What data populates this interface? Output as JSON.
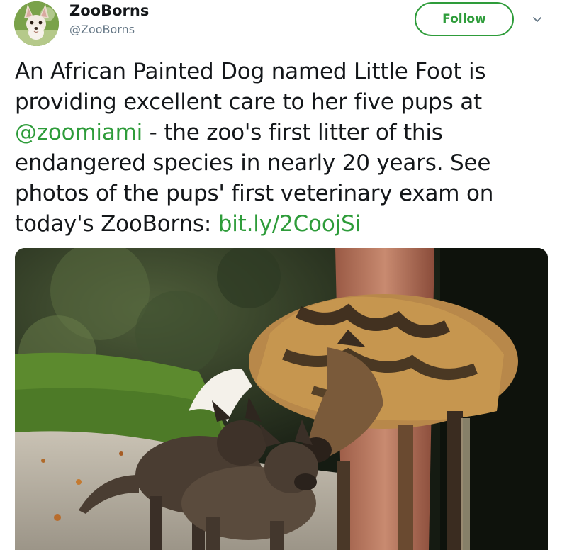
{
  "user": {
    "display_name": "ZooBorns",
    "handle": "@ZooBorns",
    "avatar_icon": "fennec-fox-avatar"
  },
  "actions": {
    "follow_label": "Follow",
    "more_icon": "chevron-down-icon"
  },
  "tweet": {
    "segments": [
      {
        "text": "An African Painted Dog named Little Foot is",
        "type": "text"
      },
      {
        "text": "providing excellent care to her five pups at",
        "type": "text"
      },
      {
        "text": "@zoomiami",
        "type": "mention"
      },
      {
        "text": " - the zoo's first litter of this",
        "type": "text"
      },
      {
        "text": "endangered species in nearly 20 years. See",
        "type": "text"
      },
      {
        "text": "photos of the pups' first veterinary exam on",
        "type": "text"
      },
      {
        "text": "today's ZooBorns: ",
        "type": "text"
      },
      {
        "text": "bit.ly/2CoojSi",
        "type": "link"
      }
    ]
  },
  "media": {
    "subject_icon": "african-painted-dog-photo"
  },
  "colors": {
    "accent": "#2e9c3a",
    "text": "#14171a",
    "muted": "#657786"
  }
}
